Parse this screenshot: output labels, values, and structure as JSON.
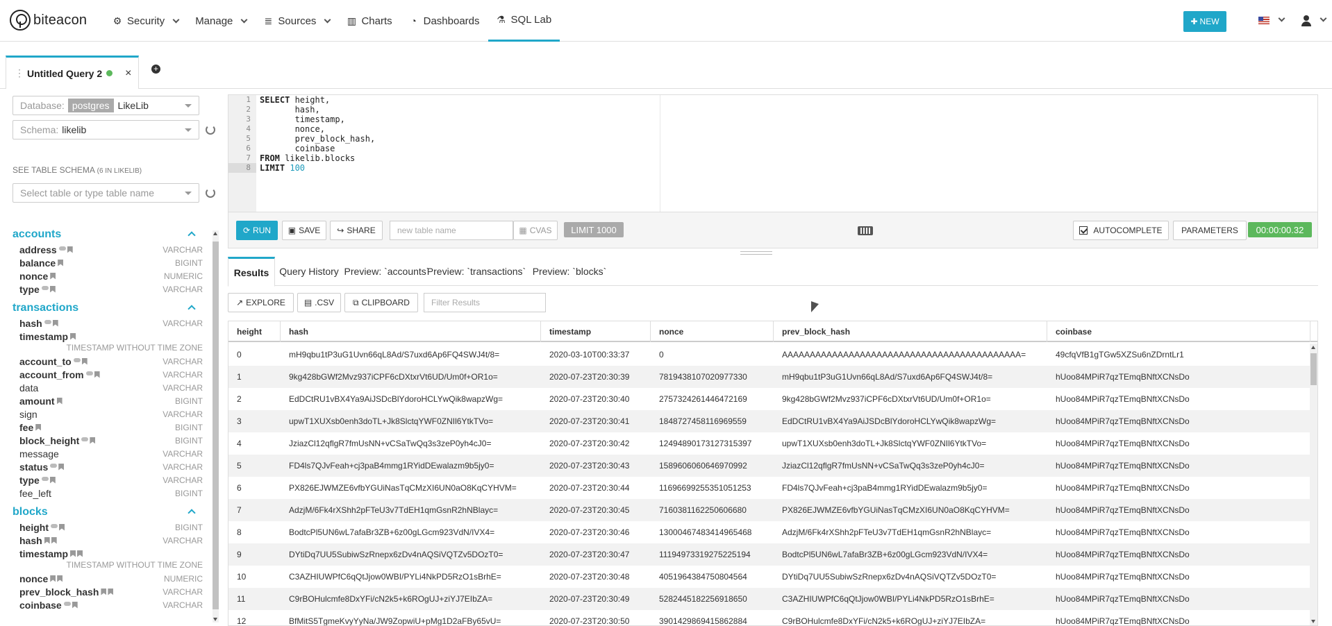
{
  "app": {
    "logo_text": "biteacon",
    "brand_color": "#20a7c9"
  },
  "nav": {
    "items": [
      {
        "label": "Security",
        "icon": "gear-icon",
        "caret": true
      },
      {
        "label": "Manage",
        "icon": "",
        "caret": true
      },
      {
        "label": "Sources",
        "icon": "database-icon",
        "caret": true
      },
      {
        "label": "Charts",
        "icon": "bar-chart-icon",
        "caret": false
      },
      {
        "label": "Dashboards",
        "icon": "dashboard-icon",
        "caret": false
      },
      {
        "label": "SQL Lab",
        "icon": "flask-icon",
        "caret": false,
        "active": true
      }
    ],
    "new_label": "NEW"
  },
  "query_tab": {
    "title": "Untitled Query 2",
    "status_color": "#5cb85c"
  },
  "sidebar": {
    "database_placeholder": "Database:",
    "database_engine": "postgres",
    "database_name": "LikeLib",
    "schema_placeholder": "Schema:",
    "schema_value": "likelib",
    "see_schema_label": "SEE TABLE SCHEMA",
    "see_schema_count": "(6 IN LIKELIB)",
    "table_select_placeholder": "Select table or type table name",
    "tables": [
      {
        "name": "accounts",
        "columns": [
          {
            "name": "address",
            "type": "VARCHAR",
            "bold": true,
            "key": true
          },
          {
            "name": "balance",
            "type": "BIGINT",
            "bold": true,
            "key": false
          },
          {
            "name": "nonce",
            "type": "NUMERIC",
            "bold": true,
            "key": false
          },
          {
            "name": "type",
            "type": "VARCHAR",
            "bold": true,
            "key": true
          }
        ]
      },
      {
        "name": "transactions",
        "columns": [
          {
            "name": "hash",
            "type": "VARCHAR",
            "bold": true,
            "key": true
          },
          {
            "name": "timestamp",
            "type": "",
            "subtype": "TIMESTAMP WITHOUT TIME ZONE",
            "bold": true,
            "key": false
          },
          {
            "name": "account_to",
            "type": "VARCHAR",
            "bold": true,
            "key": true
          },
          {
            "name": "account_from",
            "type": "VARCHAR",
            "bold": true,
            "key": true
          },
          {
            "name": "data",
            "type": "VARCHAR",
            "bold": false,
            "key": false,
            "noicon": true
          },
          {
            "name": "amount",
            "type": "BIGINT",
            "bold": true,
            "key": false
          },
          {
            "name": "sign",
            "type": "VARCHAR",
            "bold": false,
            "key": false,
            "noicon": true
          },
          {
            "name": "fee",
            "type": "BIGINT",
            "bold": true,
            "key": false
          },
          {
            "name": "block_height",
            "type": "BIGINT",
            "bold": true,
            "key": true
          },
          {
            "name": "message",
            "type": "VARCHAR",
            "bold": false,
            "key": false,
            "noicon": true
          },
          {
            "name": "status",
            "type": "VARCHAR",
            "bold": true,
            "key": true
          },
          {
            "name": "type",
            "type": "VARCHAR",
            "bold": true,
            "key": true
          },
          {
            "name": "fee_left",
            "type": "BIGINT",
            "bold": false,
            "key": false,
            "noicon": true
          }
        ]
      },
      {
        "name": "blocks",
        "columns": [
          {
            "name": "height",
            "type": "BIGINT",
            "bold": true,
            "key": true
          },
          {
            "name": "hash",
            "type": "VARCHAR",
            "bold": true,
            "key": false,
            "double": true
          },
          {
            "name": "timestamp",
            "type": "",
            "subtype": "TIMESTAMP WITHOUT TIME ZONE",
            "bold": true,
            "key": false,
            "double": true
          },
          {
            "name": "nonce",
            "type": "NUMERIC",
            "bold": true,
            "key": false,
            "double": true
          },
          {
            "name": "prev_block_hash",
            "type": "VARCHAR",
            "bold": true,
            "key": false,
            "double": true
          },
          {
            "name": "coinbase",
            "type": "VARCHAR",
            "bold": true,
            "key": true
          }
        ]
      }
    ]
  },
  "editor": {
    "lines": [
      [
        [
          "kw",
          "SELECT"
        ],
        [
          "t",
          " height,"
        ]
      ],
      [
        [
          "t",
          "       hash,"
        ]
      ],
      [
        [
          "t",
          "       timestamp,"
        ]
      ],
      [
        [
          "t",
          "       nonce,"
        ]
      ],
      [
        [
          "t",
          "       prev_block_hash,"
        ]
      ],
      [
        [
          "t",
          "       coinbase"
        ]
      ],
      [
        [
          "kw",
          "FROM"
        ],
        [
          "t",
          " likelib.blocks"
        ]
      ],
      [
        [
          "kw",
          "LIMIT"
        ],
        [
          "t",
          " "
        ],
        [
          "num",
          "100"
        ]
      ]
    ],
    "active_line": 8
  },
  "toolbar": {
    "run_label": "RUN",
    "save_label": "SAVE",
    "share_label": "SHARE",
    "table_name_placeholder": "new table name",
    "cvas_label": "CVAS",
    "limit_label": "LIMIT 1000",
    "autocomplete_label": "AUTOCOMPLETE",
    "parameters_label": "PARAMETERS",
    "timer": "00:00:00.32"
  },
  "result_tabs": [
    {
      "label": "Results",
      "active": true
    },
    {
      "label": "Query History",
      "active": false
    },
    {
      "label": "Preview: `accounts`",
      "active": false
    },
    {
      "label": "Preview: `transactions`",
      "active": false
    },
    {
      "label": "Preview: `blocks`",
      "active": false
    }
  ],
  "result_actions": {
    "explore_label": "EXPLORE",
    "csv_label": ".CSV",
    "clipboard_label": "CLIPBOARD",
    "filter_placeholder": "Filter Results"
  },
  "results": {
    "columns": [
      "height",
      "hash",
      "timestamp",
      "nonce",
      "prev_block_hash",
      "coinbase"
    ],
    "rows": [
      [
        "0",
        "mH9qbu1tP3uG1Uvn66qL8Ad/S7uxd6Ap6FQ4SWJ4t/8=",
        "2020-03-10T00:33:37",
        "0",
        "AAAAAAAAAAAAAAAAAAAAAAAAAAAAAAAAAAAAAAAAAAA=",
        "49cfqVfB1gTGw5XZSu6nZDrntLr1"
      ],
      [
        "1",
        "9kg428bGWf2Mvz937iCPF6cDXtxrVt6UD/Um0f+OR1o=",
        "2020-07-23T20:30:39",
        "7819438107020977330",
        "mH9qbu1tP3uG1Uvn66qL8Ad/S7uxd6Ap6FQ4SWJ4t/8=",
        "hUoo84MPiR7qzTEmqBNftXCNsDo"
      ],
      [
        "2",
        "EdDCtRU1vBX4Ya9AiJSDcBlYdoroHCLYwQik8wapzWg=",
        "2020-07-23T20:30:40",
        "2757324261446472169",
        "9kg428bGWf2Mvz937iCPF6cDXtxrVt6UD/Um0f+OR1o=",
        "hUoo84MPiR7qzTEmqBNftXCNsDo"
      ],
      [
        "3",
        "upwT1XUXsb0enh3doTL+Jk8SlctqYWF0ZNIl6YtkTVo=",
        "2020-07-23T20:30:41",
        "1848727458116969559",
        "EdDCtRU1vBX4Ya9AiJSDcBlYdoroHCLYwQik8wapzWg=",
        "hUoo84MPiR7qzTEmqBNftXCNsDo"
      ],
      [
        "4",
        "JziazCl12qflgR7fmUsNN+vCSaTwQq3s3zeP0yh4cJ0=",
        "2020-07-23T20:30:42",
        "12494890173127315397",
        "upwT1XUXsb0enh3doTL+Jk8SlctqYWF0ZNIl6YtkTVo=",
        "hUoo84MPiR7qzTEmqBNftXCNsDo"
      ],
      [
        "5",
        "FD4ls7QJvFeah+cj3paB4mmg1RYidDEwalazm9b5jy0=",
        "2020-07-23T20:30:43",
        "1589606060646970992",
        "JziazCl12qflgR7fmUsNN+vCSaTwQq3s3zeP0yh4cJ0=",
        "hUoo84MPiR7qzTEmqBNftXCNsDo"
      ],
      [
        "6",
        "PX826EJWMZE6vfbYGUiNasTqCMzXI6UN0aO8KqCYHVM=",
        "2020-07-23T20:30:44",
        "11696699255351051253",
        "FD4ls7QJvFeah+cj3paB4mmg1RYidDEwalazm9b5jy0=",
        "hUoo84MPiR7qzTEmqBNftXCNsDo"
      ],
      [
        "7",
        "AdzjM/6Fk4rXShh2pFTeU3v7TdEH1qmGsnR2hNBlayc=",
        "2020-07-23T20:30:45",
        "7160381162250606680",
        "PX826EJWMZE6vfbYGUiNasTqCMzXI6UN0aO8KqCYHVM=",
        "hUoo84MPiR7qzTEmqBNftXCNsDo"
      ],
      [
        "8",
        "BodtcPl5UN6wL7afaBr3ZB+6z00gLGcm923VdN/IVX4=",
        "2020-07-23T20:30:46",
        "13000467483414965468",
        "AdzjM/6Fk4rXShh2pFTeU3v7TdEH1qmGsnR2hNBlayc=",
        "hUoo84MPiR7qzTEmqBNftXCNsDo"
      ],
      [
        "9",
        "DYtiDq7UU5SubiwSzRnepx6zDv4nAQSiVQTZv5DOzT0=",
        "2020-07-23T20:30:47",
        "11194973319275225194",
        "BodtcPl5UN6wL7afaBr3ZB+6z00gLGcm923VdN/IVX4=",
        "hUoo84MPiR7qzTEmqBNftXCNsDo"
      ],
      [
        "10",
        "C3AZHIUWPfC6qQtJjow0WBI/PYLi4NkPD5RzO1sBrhE=",
        "2020-07-23T20:30:48",
        "4051964384750804564",
        "DYtiDq7UU5SubiwSzRnepx6zDv4nAQSiVQTZv5DOzT0=",
        "hUoo84MPiR7qzTEmqBNftXCNsDo"
      ],
      [
        "11",
        "C9rBOHulcmfe8DxYFi/cN2k5+k6ROgUJ+ziYJ7EIbZA=",
        "2020-07-23T20:30:49",
        "5282445182256918650",
        "C3AZHIUWPfC6qQtJjow0WBI/PYLi4NkPD5RzO1sBrhE=",
        "hUoo84MPiR7qzTEmqBNftXCNsDo"
      ],
      [
        "12",
        "BfMitS5TgmeKvyYyNa/JW9ZopwiU+pMg1D2aFBy65vU=",
        "2020-07-23T20:30:50",
        "3901429869415862884",
        "C9rBOHulcmfe8DxYFi/cN2k5+k6ROgUJ+ziYJ7EIbZA=",
        "hUoo84MPiR7qzTEmqBNftXCNsDo"
      ]
    ]
  }
}
